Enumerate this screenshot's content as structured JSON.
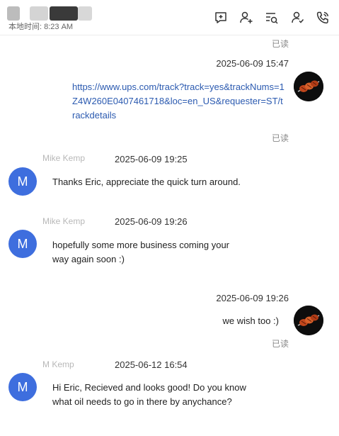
{
  "header": {
    "local_time": "本地时间: 8:23 AM",
    "tools": [
      {
        "name": "new-chat-icon"
      },
      {
        "name": "add-contact-icon"
      },
      {
        "name": "search-history-icon"
      },
      {
        "name": "contact-profile-icon"
      },
      {
        "name": "phone-call-icon"
      }
    ]
  },
  "messages": [
    {
      "direction": "out",
      "read_above": "已读",
      "timestamp": "2025-06-09 15:47",
      "text": "https://www.ups.com/track?track=yes&trackNums=1Z4W260E0407461718&loc=en_US&requester=ST/trackdetails",
      "is_link": true,
      "read_below": "已读"
    },
    {
      "direction": "in",
      "sender": "Mike Kemp",
      "avatar_letter": "M",
      "timestamp": "2025-06-09 19:25",
      "text": "Thanks Eric, appreciate the quick turn around."
    },
    {
      "direction": "in",
      "sender": "Mike Kemp",
      "avatar_letter": "M",
      "timestamp": "2025-06-09 19:26",
      "text_lines": [
        "hopefully some more business coming your",
        "way again soon :)"
      ]
    },
    {
      "direction": "out",
      "timestamp": "2025-06-09 19:26",
      "text": "we wish too :)",
      "read_below": "已读"
    },
    {
      "direction": "in",
      "sender": "M Kemp",
      "avatar_letter": "M",
      "timestamp": "2025-06-12 16:54",
      "text_lines": [
        "Hi Eric, Recieved and looks good! Do you know",
        "what oil needs to go in there by anychance?"
      ]
    }
  ],
  "colors": {
    "avatar_m": "#3e6ede",
    "link": "#2b5ab0",
    "read_status": "#888888"
  }
}
